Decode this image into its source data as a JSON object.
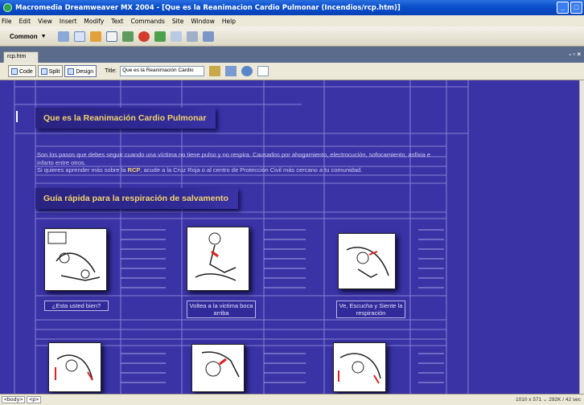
{
  "window": {
    "title": "Macromedia Dreamweaver MX 2004 - [Que es la Reanimacion Cardio Pulmonar (Incendios/rcp.htm)]",
    "buttons": [
      "_",
      "□",
      "×"
    ]
  },
  "menubar": [
    "File",
    "Edit",
    "View",
    "Insert",
    "Modify",
    "Text",
    "Commands",
    "Site",
    "Window",
    "Help"
  ],
  "insert_bar": {
    "category": "Common",
    "caret": "▼"
  },
  "doc_tab": {
    "name": "rcp.htm",
    "controls": "- ▫ ×"
  },
  "doc_toolbar": {
    "code_label": "Code",
    "split_label": "Split",
    "design_label": "Design",
    "title_label": "Title:",
    "title_value": "Que es la Reanimación Cardio"
  },
  "page": {
    "heading1": "Que es la Reanimación Cardio Pulmonar",
    "intro_line1": "Son los pasos que debes seguir cuando una víctima no tiene pulso y no respira. Causados por ahogamiento, electrocución, sofocamiento, asfixia e infarto entre otros.",
    "intro_pre": "Si quieres aprender más sobre la ",
    "intro_highlight": "RCP",
    "intro_post": ", acude a la Cruz Roja o al centro de Protección Civil más cercano a tu comunidad.",
    "heading2": "Guía rápida para la respiración de salvamento",
    "captions": [
      "¿Esta usted bien?",
      "Voltea a la victima boca arriba",
      "Ve, Escucha y Siente la respiración"
    ]
  },
  "status": {
    "tags": [
      "<body>",
      "<p>"
    ],
    "info": "1010 x 571 ⌄ 292K / 42 sec"
  },
  "colors": {
    "canvas_bg": "#3a33a6",
    "heading_text": "#f3d36b",
    "title_bar": "#0a4fcc"
  }
}
